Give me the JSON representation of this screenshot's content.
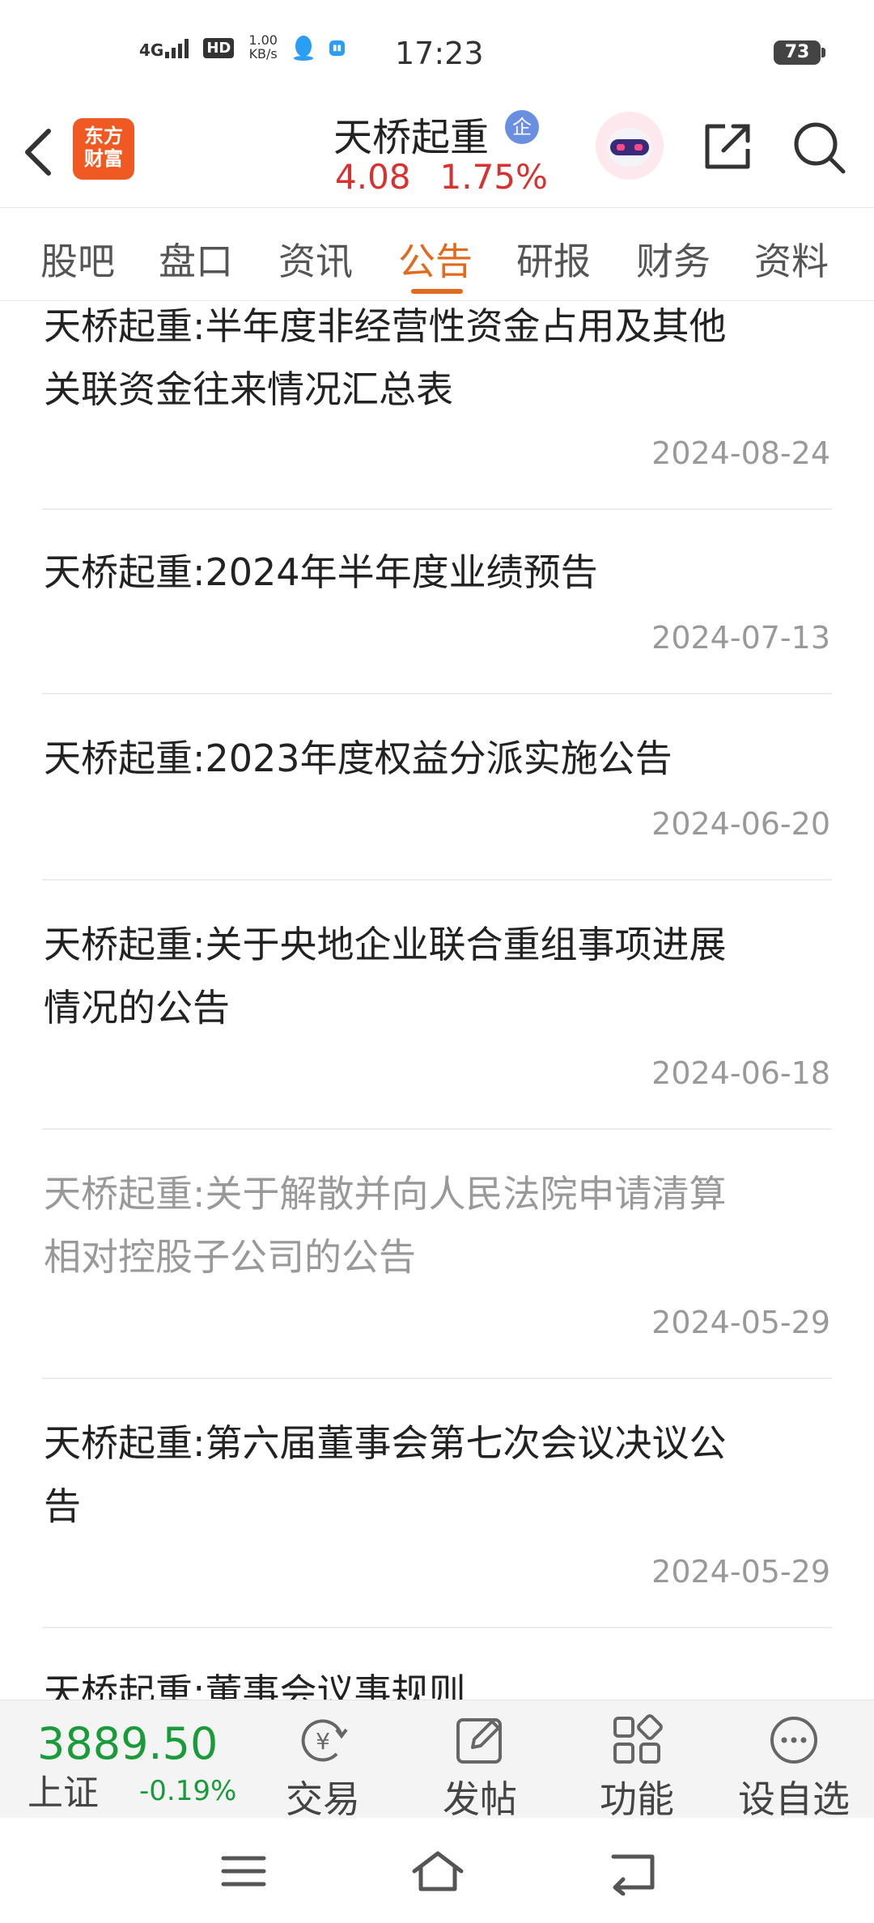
{
  "status_bar": {
    "network": "4G",
    "hd": "HD",
    "speed_value": "1.00",
    "speed_unit": "KB/s",
    "time": "17:23",
    "battery": "73"
  },
  "header": {
    "logo_text_line1": "东方",
    "logo_text_line2": "财富",
    "stock_name": "天桥起重",
    "stock_badge": "企",
    "price": "4.08",
    "change_pct": "1.75%"
  },
  "tabs": [
    {
      "label": "股吧"
    },
    {
      "label": "盘口"
    },
    {
      "label": "资讯"
    },
    {
      "label": "公告",
      "active": true
    },
    {
      "label": "研报"
    },
    {
      "label": "财务"
    },
    {
      "label": "资料"
    }
  ],
  "announcements": [
    {
      "title_line1": "天桥起重:半年度非经营性资金占用及其他",
      "title_line2": "关联资金往来情况汇总表",
      "date": "2024-08-24",
      "read": false
    },
    {
      "title_line1": "天桥起重:2024年半年度业绩预告",
      "title_line2": "",
      "date": "2024-07-13",
      "read": false
    },
    {
      "title_line1": "天桥起重:2023年度权益分派实施公告",
      "title_line2": "",
      "date": "2024-06-20",
      "read": false
    },
    {
      "title_line1": "天桥起重:关于央地企业联合重组事项进展",
      "title_line2": "情况的公告",
      "date": "2024-06-18",
      "read": false
    },
    {
      "title_line1": "天桥起重:关于解散并向人民法院申请清算",
      "title_line2": "相对控股子公司的公告",
      "date": "2024-05-29",
      "read": true
    },
    {
      "title_line1": "天桥起重:第六届董事会第七次会议决议公",
      "title_line2": "告",
      "date": "2024-05-29",
      "read": false
    },
    {
      "title_line1": "天桥起重:董事会议事规则",
      "title_line2": "",
      "date": "",
      "read": false
    }
  ],
  "bottom_bar": {
    "index_value": "3889.50",
    "index_name": "上证",
    "index_change": "-0.19%",
    "items": [
      {
        "label": "交易",
        "icon": "yuan-exchange-icon"
      },
      {
        "label": "发帖",
        "icon": "edit-icon"
      },
      {
        "label": "功能",
        "icon": "grid-icon"
      },
      {
        "label": "设自选",
        "icon": "more-dots-icon"
      }
    ]
  },
  "colors": {
    "accent": "#e26a1e",
    "up_red": "#d93030",
    "down_green": "#1a9b3a",
    "brand": "#f05a22"
  }
}
